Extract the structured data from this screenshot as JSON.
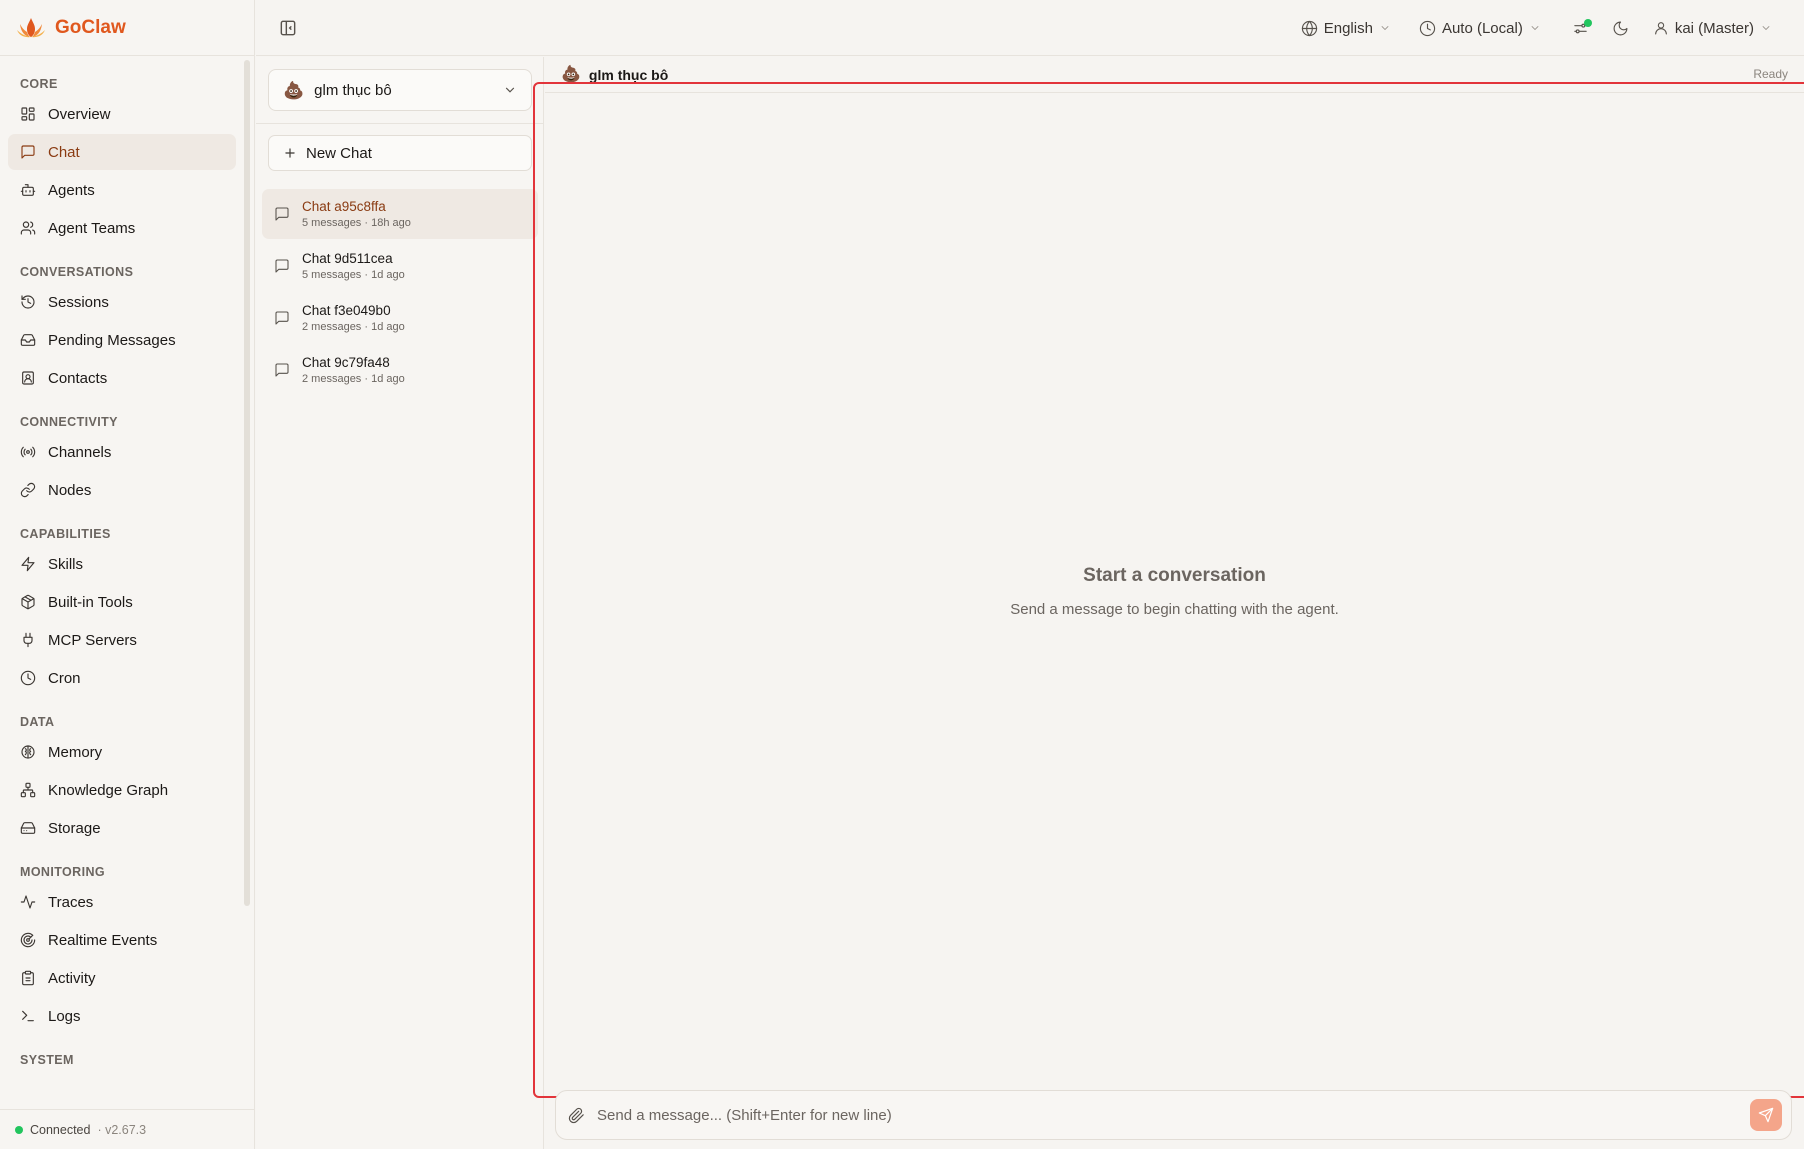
{
  "brand": {
    "name": "GoClaw"
  },
  "sidebar": {
    "sections": [
      {
        "title": "CORE",
        "items": [
          {
            "label": "Overview",
            "icon": "layout-grid-icon"
          },
          {
            "label": "Chat",
            "icon": "message-square-icon",
            "active": true
          },
          {
            "label": "Agents",
            "icon": "bot-icon"
          },
          {
            "label": "Agent Teams",
            "icon": "users-icon"
          }
        ]
      },
      {
        "title": "CONVERSATIONS",
        "items": [
          {
            "label": "Sessions",
            "icon": "history-icon"
          },
          {
            "label": "Pending Messages",
            "icon": "inbox-icon"
          },
          {
            "label": "Contacts",
            "icon": "contact-icon"
          }
        ]
      },
      {
        "title": "CONNECTIVITY",
        "items": [
          {
            "label": "Channels",
            "icon": "radio-icon"
          },
          {
            "label": "Nodes",
            "icon": "link-icon"
          }
        ]
      },
      {
        "title": "CAPABILITIES",
        "items": [
          {
            "label": "Skills",
            "icon": "zap-icon"
          },
          {
            "label": "Built-in Tools",
            "icon": "package-icon"
          },
          {
            "label": "MCP Servers",
            "icon": "plug-icon"
          },
          {
            "label": "Cron",
            "icon": "clock-icon"
          }
        ]
      },
      {
        "title": "DATA",
        "items": [
          {
            "label": "Memory",
            "icon": "brain-icon"
          },
          {
            "label": "Knowledge Graph",
            "icon": "network-icon"
          },
          {
            "label": "Storage",
            "icon": "hard-drive-icon"
          }
        ]
      },
      {
        "title": "MONITORING",
        "items": [
          {
            "label": "Traces",
            "icon": "activity-icon"
          },
          {
            "label": "Realtime Events",
            "icon": "radar-icon"
          },
          {
            "label": "Activity",
            "icon": "clipboard-icon"
          },
          {
            "label": "Logs",
            "icon": "terminal-icon"
          }
        ]
      },
      {
        "title": "SYSTEM",
        "items": []
      }
    ],
    "status": {
      "label": "Connected",
      "version": "· v2.67.3"
    }
  },
  "topbar": {
    "language": "English",
    "timezone": "Auto (Local)",
    "user": "kai (Master)"
  },
  "chatlist": {
    "agent": "glm thục bô",
    "new_chat_label": "New Chat",
    "chats": [
      {
        "title": "Chat a95c8ffa",
        "meta": "5 messages · 18h ago",
        "active": true
      },
      {
        "title": "Chat 9d511cea",
        "meta": "5 messages · 1d ago"
      },
      {
        "title": "Chat f3e049b0",
        "meta": "2 messages · 1d ago"
      },
      {
        "title": "Chat 9c79fa48",
        "meta": "2 messages · 1d ago"
      }
    ]
  },
  "main": {
    "agent_name": "glm thục bô",
    "status": "Ready",
    "empty_title": "Start a conversation",
    "empty_subtitle": "Send a message to begin chatting with the agent.",
    "composer_placeholder": "Send a message... (Shift+Enter for new line)"
  },
  "colors": {
    "accent": "#e0581e",
    "active_text": "#8a3b12",
    "highlight_border": "#e2343a",
    "status_green": "#22c55e"
  }
}
